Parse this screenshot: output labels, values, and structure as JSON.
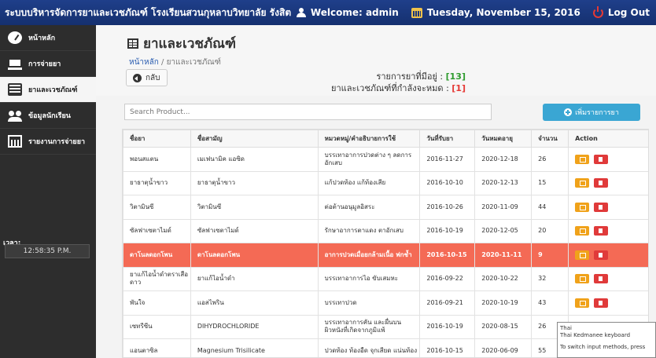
{
  "topbar": {
    "brand": "ระบบบริหารจัดการยาและเวชภัณฑ์ โรงเรียนสวนกุหลาบวิทยาลัย รังสิต",
    "welcome": "Welcome: admin",
    "date": "Tuesday, November 15, 2016",
    "logout": "Log Out"
  },
  "sidebar": {
    "items": [
      {
        "label": "หน้าหลัก",
        "icon": "dashboard-icon"
      },
      {
        "label": "การจ่ายยา",
        "icon": "cart-icon"
      },
      {
        "label": "ยาและเวชภัณฑ์",
        "icon": "list-icon"
      },
      {
        "label": "ข้อมูลนักเรียน",
        "icon": "users-icon"
      },
      {
        "label": "รายงานการจ่ายยา",
        "icon": "bar-chart-icon"
      }
    ],
    "time_label": "เวลา:",
    "time_value": "12:58:35 P.M."
  },
  "page": {
    "title": "ยาและเวชภัณฑ์",
    "breadcrumb_home": "หน้าหลัก",
    "breadcrumb_sep": " / ",
    "breadcrumb_current": "ยาและเวชภัณฑ์",
    "back_label": "กลับ",
    "stock_label": "รายการยาที่มีอยู่ : ",
    "stock_count": "[13]",
    "expiring_label": "ยาและเวชภัณฑ์ที่กำลังจะหมด : ",
    "expiring_count": "[1]"
  },
  "search": {
    "placeholder": "Search Product..."
  },
  "add_button": "เพิ่มรายการยา",
  "table": {
    "headers": [
      "ชื่อยา",
      "ชื่อสามัญ",
      "หมวดหมู่/คำอธิบายการใช้",
      "วันที่รับยา",
      "วันหมดอายุ",
      "จำนวน",
      "Action"
    ],
    "rows": [
      {
        "name": "พอนสแตน",
        "generic": "เมเฟนามิค แอซิด",
        "desc": "บรรเทาอาการปวดต่าง ๆ ลดการอักเสบ",
        "received": "2016-11-27",
        "expiry": "2020-12-18",
        "qty": "26"
      },
      {
        "name": "ยาธาตุน้ำขาว",
        "generic": "ยาธาตุน้ำขาว",
        "desc": "แก้ปวดท้อง แก้ท้องเสีย",
        "received": "2016-10-10",
        "expiry": "2020-12-13",
        "qty": "15"
      },
      {
        "name": "วิตามินซี",
        "generic": "วิตามินซี",
        "desc": "ต่อต้านอนุมูลอิสระ",
        "received": "2016-10-26",
        "expiry": "2020-11-09",
        "qty": "44"
      },
      {
        "name": "ซัลฟาเซตาไมด์",
        "generic": "ซัลฟาเซตาไมด์",
        "desc": "รักษาอาการตาแดง ตาอักเสบ",
        "received": "2016-10-19",
        "expiry": "2020-12-05",
        "qty": "20"
      },
      {
        "name": "ดาโนลดอกโพน",
        "generic": "ดาโนลดอกโพน",
        "desc": "อาการปวดเมื่อยกล้ามเนื้อ ฟกช้ำ",
        "received": "2016-10-15",
        "expiry": "2020-11-11",
        "qty": "9"
      },
      {
        "name": "ยาแก้ไอน้ำดำตราเสือดาว",
        "generic": "ยาแก้ไอน้ำดำ",
        "desc": "บรรเทาอาการไอ ขับเสมหะ",
        "received": "2016-09-22",
        "expiry": "2020-10-22",
        "qty": "32"
      },
      {
        "name": "พันใจ",
        "generic": "แอสไพริน",
        "desc": "บรรเทาปวด",
        "received": "2016-09-21",
        "expiry": "2020-10-19",
        "qty": "43"
      },
      {
        "name": "เซทรีซีน",
        "generic": "DIHYDROCHLORIDE",
        "desc": "บรรเทาอาการคัน และผื่นบนผิวหนังที่เกิดจากภูมิแพ้",
        "received": "2016-10-19",
        "expiry": "2020-08-15",
        "qty": "26"
      },
      {
        "name": "แอนตาซิล",
        "generic": "Magnesium Trisilicate",
        "desc": "ปวดท้อง ท้องอืด จุกเสียด แน่นท้อง",
        "received": "2016-10-15",
        "expiry": "2020-06-09",
        "qty": "55"
      }
    ]
  },
  "tooltip": {
    "line1": "Thai",
    "line2": "Thai Kedmanee keyboard",
    "line3": "To switch input methods, press"
  },
  "colors": {
    "topbar": "#1f3f8a",
    "highlight_row": "#f46a55",
    "edit_button": "#f0a21a",
    "delete_button": "#e03a3a",
    "add_button": "#3aa6d3",
    "stock_ok": "#2e9b2e",
    "stock_warn": "#e53935"
  }
}
